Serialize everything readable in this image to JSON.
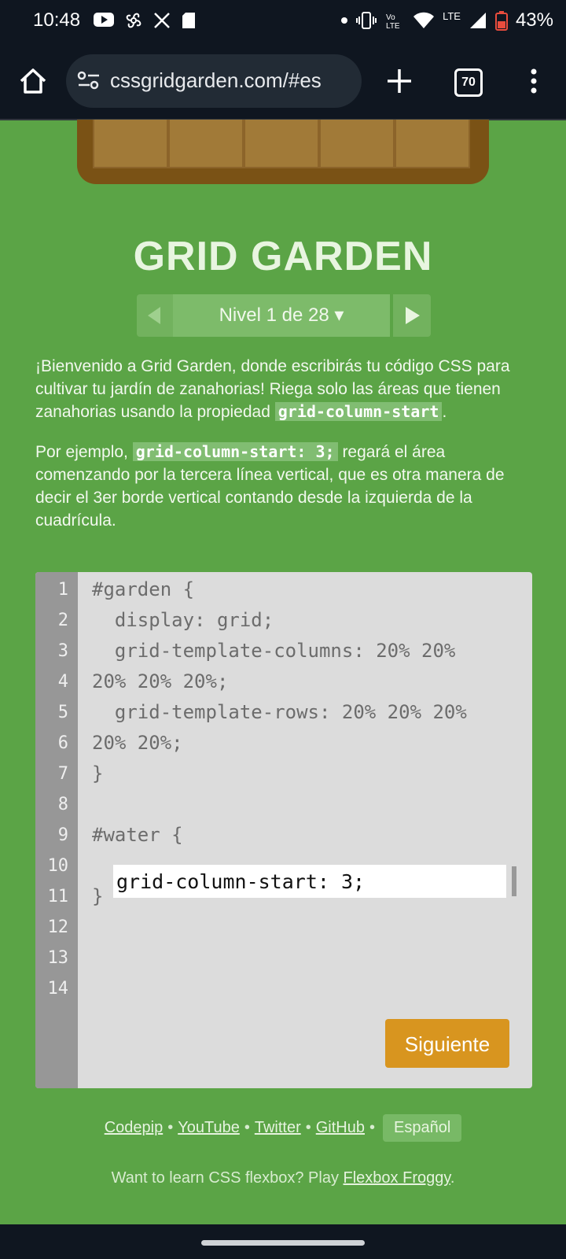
{
  "status": {
    "time": "10:48",
    "battery": "43%",
    "network": "LTE",
    "volte": "Vo LTE"
  },
  "browser": {
    "url": "cssgridgarden.com/#es",
    "tab_count": "70"
  },
  "game": {
    "title": "GRID GARDEN",
    "level_label": "Nivel 1 de 28 ▾",
    "intro_before": "¡Bienvenido a Grid Garden, donde escribirás tu código CSS para cultivar tu jardín de zanahorias! Riega solo las áreas que tienen zanahorias usando la propiedad ",
    "intro_code": "grid-column-start",
    "intro_after": ".",
    "example_before": "Por ejemplo, ",
    "example_code": "grid-column-start: 3;",
    "example_after": " regará el área comenzando por la tercera línea vertical, que es otra manera de decir el 3er borde vertical contando desde la izquierda de la cuadrícula."
  },
  "editor": {
    "line_numbers": [
      "1",
      "2",
      "3",
      "4",
      "5",
      "6",
      "7",
      "8",
      "9",
      "10",
      "11",
      "12",
      "13",
      "14"
    ],
    "lines": {
      "l1": "#garden {",
      "l2": "  display: grid;",
      "l3": "  grid-template-columns: 20% 20%",
      "l4": "20% 20% 20%;",
      "l5": "  grid-template-rows: 20% 20% 20%",
      "l6": "20% 20%;",
      "l7": "}",
      "l9": "#water {",
      "l11": "}"
    },
    "answer_value": "grid-column-start: 3;",
    "next_button": "Siguiente"
  },
  "footer": {
    "links": [
      "Codepip",
      "YouTube",
      "Twitter",
      "GitHub"
    ],
    "language": "Español",
    "promo_text": "Want to learn CSS flexbox? Play ",
    "promo_link": "Flexbox Froggy",
    "promo_end": "."
  },
  "colors": {
    "page_bg": "#5ba446",
    "button": "#d8951f",
    "editor_bg": "#dcdcdc"
  }
}
